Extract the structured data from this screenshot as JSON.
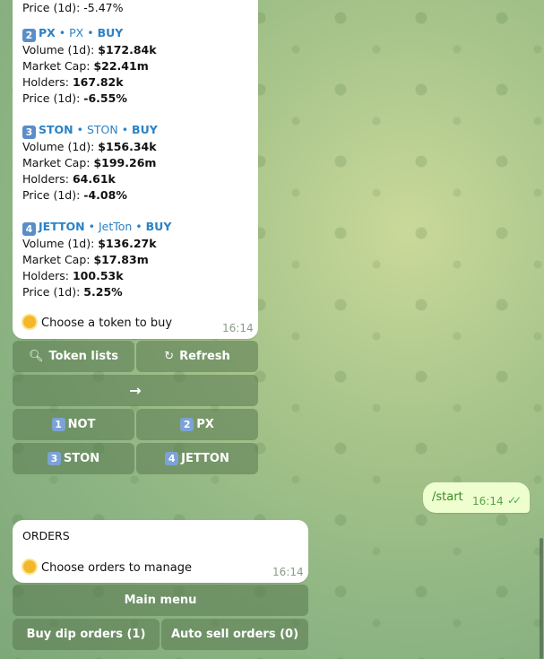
{
  "message_tokens": {
    "partial_top": "Price (1d): -5.47%",
    "tokens": [
      {
        "number": "2",
        "name": "PX",
        "symbol": "PX",
        "action": "BUY",
        "volume_label": "Volume (1d): ",
        "volume": "$172.84k",
        "mcap_label": "Market Cap: ",
        "mcap": "$22.41m",
        "holders_label": "Holders: ",
        "holders": "167.82k",
        "price_label": "Price (1d): ",
        "price": "-6.55%"
      },
      {
        "number": "3",
        "name": "STON",
        "symbol": "STON",
        "action": "BUY",
        "volume_label": "Volume (1d): ",
        "volume": "$156.34k",
        "mcap_label": "Market Cap: ",
        "mcap": "$199.26m",
        "holders_label": "Holders: ",
        "holders": "64.61k",
        "price_label": "Price (1d): ",
        "price": "-4.08%"
      },
      {
        "number": "4",
        "name": "JETTON",
        "symbol": "JetTon",
        "action": "BUY",
        "volume_label": "Volume (1d): ",
        "volume": "$136.27k",
        "mcap_label": "Market Cap: ",
        "mcap": "$17.83m",
        "holders_label": "Holders: ",
        "holders": "100.53k",
        "price_label": "Price (1d): ",
        "price": "5.25%"
      }
    ],
    "separator": " • ",
    "footer": "Choose a token to buy",
    "time": "16:14"
  },
  "keyboard_tokens": {
    "token_lists": "Token lists",
    "refresh": "Refresh",
    "next_arrow": "→",
    "btn_not": {
      "number": "1",
      "label": "NOT"
    },
    "btn_px": {
      "number": "2",
      "label": "PX"
    },
    "btn_ston": {
      "number": "3",
      "label": "STON"
    },
    "btn_jetton": {
      "number": "4",
      "label": "JETTON"
    }
  },
  "outgoing": {
    "text": "/start",
    "time": "16:14",
    "checks": "✓✓"
  },
  "message_orders": {
    "title": "ORDERS",
    "footer": "Choose orders to manage",
    "time": "16:14"
  },
  "keyboard_orders": {
    "main_menu": "Main menu",
    "buy_dip": "Buy dip orders (1)",
    "auto_sell": "Auto sell orders (0)"
  },
  "icons": {
    "search": "search-icon",
    "refresh": "refresh-icon",
    "sun": "sun-icon"
  }
}
